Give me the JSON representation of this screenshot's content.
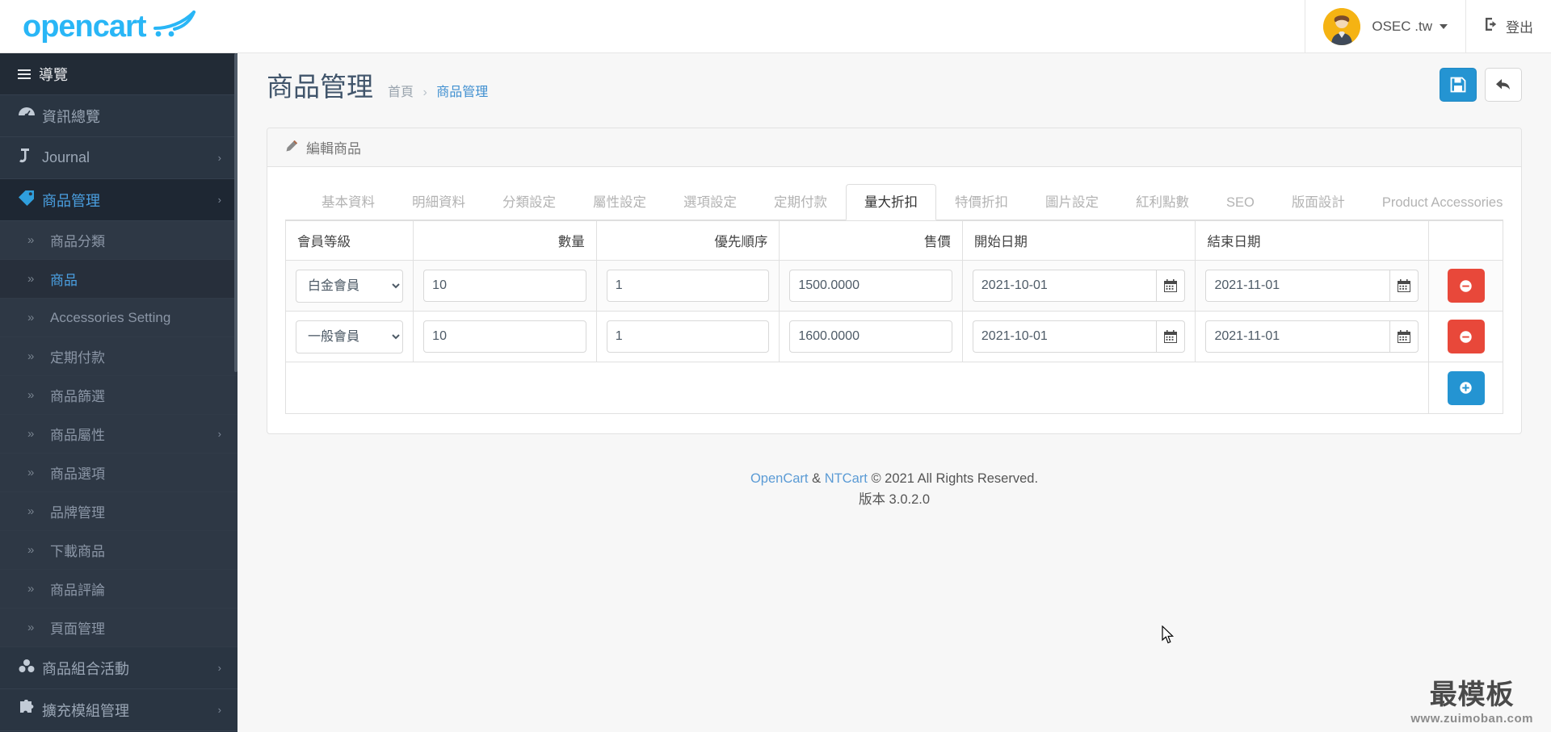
{
  "header": {
    "logo_text": "opencart",
    "logo_cart_icon": "shopping-cart-icon",
    "user_name": "OSEC .tw",
    "logout_label": "登出",
    "logout_icon": "logout-icon",
    "avatar_icon": "avatar"
  },
  "sidebar": {
    "nav_header": "導覽",
    "items": [
      {
        "label": "資訊總覽",
        "icon": "dashboard-icon",
        "has_chevron": false,
        "active": false
      },
      {
        "label": "Journal",
        "icon": "journal-icon",
        "has_chevron": true,
        "active": false
      },
      {
        "label": "商品管理",
        "icon": "tag-icon",
        "has_chevron": true,
        "active": true
      }
    ],
    "sub_items": [
      {
        "label": "商品分類",
        "active": false,
        "has_chevron": false
      },
      {
        "label": "商品",
        "active": true,
        "has_chevron": false
      },
      {
        "label": "Accessories Setting",
        "active": false,
        "has_chevron": false
      },
      {
        "label": "定期付款",
        "active": false,
        "has_chevron": false
      },
      {
        "label": "商品篩選",
        "active": false,
        "has_chevron": false
      },
      {
        "label": "商品屬性",
        "active": false,
        "has_chevron": true
      },
      {
        "label": "商品選項",
        "active": false,
        "has_chevron": false
      },
      {
        "label": "品牌管理",
        "active": false,
        "has_chevron": false
      },
      {
        "label": "下載商品",
        "active": false,
        "has_chevron": false
      },
      {
        "label": "商品評論",
        "active": false,
        "has_chevron": false
      },
      {
        "label": "頁面管理",
        "active": false,
        "has_chevron": false
      }
    ],
    "bottom_items": [
      {
        "label": "商品組合活動",
        "icon": "cubes-icon",
        "has_chevron": true
      },
      {
        "label": "擴充模組管理",
        "icon": "puzzle-icon",
        "has_chevron": true
      }
    ]
  },
  "page": {
    "title": "商品管理",
    "breadcrumb_home": "首頁",
    "breadcrumb_sep": "›",
    "breadcrumb_current": "商品管理",
    "save_icon": "save-icon",
    "back_icon": "back-arrow-icon"
  },
  "panel": {
    "heading": "編輯商品",
    "heading_icon": "pencil-icon"
  },
  "tabs": [
    {
      "label": "基本資料",
      "active": false
    },
    {
      "label": "明細資料",
      "active": false
    },
    {
      "label": "分類設定",
      "active": false
    },
    {
      "label": "屬性設定",
      "active": false
    },
    {
      "label": "選項設定",
      "active": false
    },
    {
      "label": "定期付款",
      "active": false
    },
    {
      "label": "量大折扣",
      "active": true
    },
    {
      "label": "特價折扣",
      "active": false
    },
    {
      "label": "圖片設定",
      "active": false
    },
    {
      "label": "紅利點數",
      "active": false
    },
    {
      "label": "SEO",
      "active": false
    },
    {
      "label": "版面設計",
      "active": false
    },
    {
      "label": "Product Accessories",
      "active": false
    }
  ],
  "table": {
    "columns": [
      {
        "label": "會員等級",
        "align": "left"
      },
      {
        "label": "數量",
        "align": "right"
      },
      {
        "label": "優先順序",
        "align": "right"
      },
      {
        "label": "售價",
        "align": "right"
      },
      {
        "label": "開始日期",
        "align": "left"
      },
      {
        "label": "結束日期",
        "align": "left"
      },
      {
        "label": "",
        "align": "left"
      }
    ],
    "customer_group_options": [
      "白金會員",
      "一般會員"
    ],
    "rows": [
      {
        "customer_group": "白金會員",
        "quantity": "10",
        "priority": "1",
        "price": "1500.0000",
        "date_start": "2021-10-01",
        "date_end": "2021-11-01",
        "remove_icon": "minus-circle-icon"
      },
      {
        "customer_group": "一般會員",
        "quantity": "10",
        "priority": "1",
        "price": "1600.0000",
        "date_start": "2021-10-01",
        "date_end": "2021-11-01",
        "remove_icon": "minus-circle-icon"
      }
    ],
    "add_icon": "plus-circle-icon",
    "calendar_icon": "calendar-icon"
  },
  "footer": {
    "link1": "OpenCart",
    "amp": " & ",
    "link2": "NTCart",
    "copyright": " © 2021 All Rights Reserved.",
    "version": "版本 3.0.2.0"
  },
  "watermark": {
    "cn": "最模板",
    "url": "www.zuimoban.com"
  },
  "colors": {
    "brand_blue": "#29b6f6",
    "accent_blue": "#2494d2",
    "danger_red": "#e8483a",
    "sidebar_bg": "#2a3542",
    "link_blue": "#5b9bd5"
  }
}
